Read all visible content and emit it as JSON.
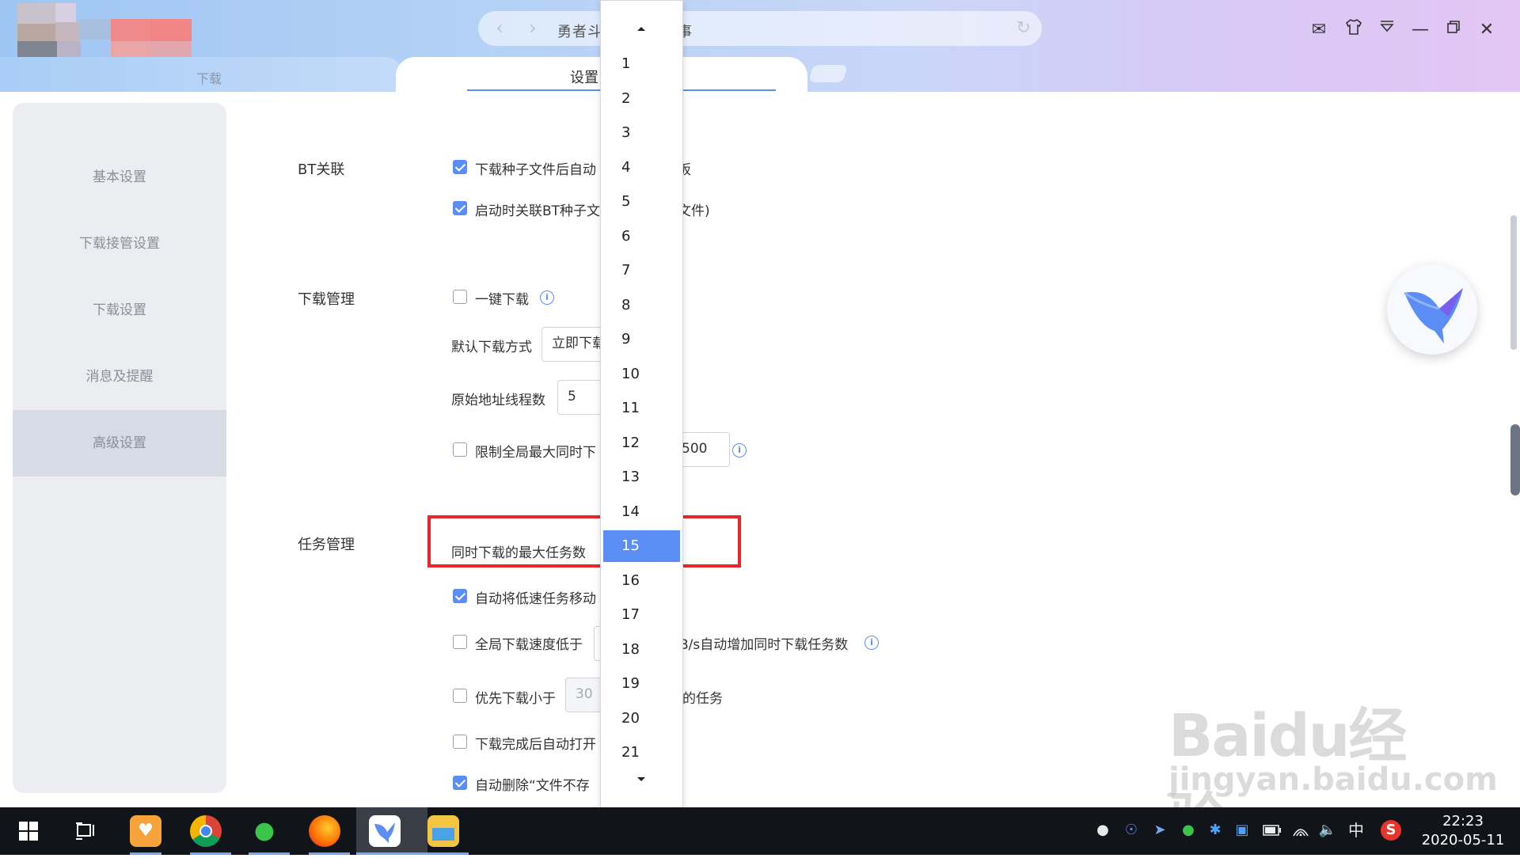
{
  "titlebar": {
    "address_text": "勇者斗　　　　故事",
    "nav_back_icon": "chevron-left-icon",
    "nav_forward_icon": "chevron-right-icon",
    "refresh_icon": "refresh-icon",
    "window_buttons": [
      "mail-icon",
      "skin-icon",
      "menu-icon",
      "minimize-icon",
      "restore-icon",
      "close-icon"
    ]
  },
  "tabs": {
    "download": "下载",
    "settings": "设置"
  },
  "sidebar": {
    "items": [
      {
        "label": "基本设置"
      },
      {
        "label": "下载接管设置"
      },
      {
        "label": "下载设置"
      },
      {
        "label": "消息及提醒"
      },
      {
        "label": "高级设置",
        "active": true
      }
    ]
  },
  "content": {
    "bt": {
      "title": "BT关联",
      "opt1": "下载种子文件后自动",
      "opt1_tail": "板",
      "opt2": "启动时关联BT种子文",
      "opt2_tail": "文件)"
    },
    "download_mgmt": {
      "title": "下载管理",
      "one_click": "一键下载",
      "default_mode_label": "默认下载方式",
      "default_mode_value": "立即下载",
      "threads_label": "原始地址线程数",
      "threads_value": "5",
      "limit_label": "限制全局最大同时下",
      "limit_value": "500"
    },
    "task_mgmt": {
      "title": "任务管理",
      "max_tasks_label": "同时下载的最大任务数",
      "auto_move": "自动将低速任务移动",
      "speed_low_label": "全局下载速度低于",
      "speed_low_tail": "B/s自动增加同时下载任务数",
      "prefer_small_label": "优先下载小于",
      "prefer_small_value": "30",
      "prefer_small_tail": "的任务",
      "open_after": "下载完成后自动打开",
      "auto_delete": "自动删除“文件不存"
    }
  },
  "dropdown": {
    "options": [
      "1",
      "2",
      "3",
      "4",
      "5",
      "6",
      "7",
      "8",
      "9",
      "10",
      "11",
      "12",
      "13",
      "14",
      "15",
      "16",
      "17",
      "18",
      "19",
      "20",
      "21"
    ],
    "selected": "15"
  },
  "watermark": {
    "main": "Baidu经验",
    "sub": "jingyan.baidu.com"
  },
  "taskbar": {
    "apps": [
      "windows-start-icon",
      "task-view-icon",
      "uc-browser-icon",
      "chrome-icon",
      "wechat-icon",
      "firefox-icon",
      "thunder-icon",
      "file-explorer-icon"
    ],
    "tray": [
      "tray-app-icon",
      "shield-icon",
      "thunder-tray-icon",
      "wechat-tray-icon",
      "bluetooth-icon",
      "network-app-icon",
      "battery-icon",
      "wifi-icon",
      "volume-icon"
    ],
    "ime": "中",
    "sogou_icon": "sogou-icon",
    "time": "22:23",
    "date": "2020-05-11"
  },
  "colors": {
    "accent": "#5b8ef5",
    "highlight_red": "#e6282d",
    "sidebar_bg": "#ebedf0",
    "sidebar_active": "#d6dbe6"
  }
}
